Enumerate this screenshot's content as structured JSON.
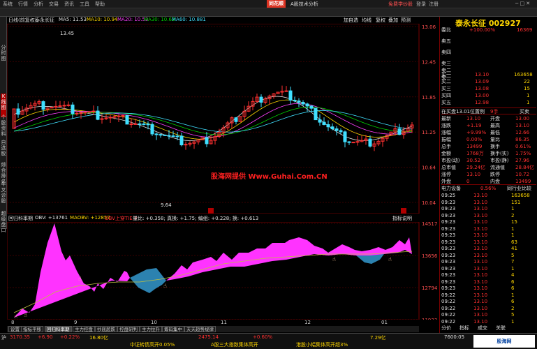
{
  "app": {
    "brand": "同花顺",
    "subtitle": "A股技术分析",
    "menus": [
      "系统",
      "行情",
      "分析",
      "交易",
      "资讯",
      "工具",
      "帮助"
    ],
    "right_links": [
      "免费学炒股",
      "登录",
      "注册"
    ]
  },
  "stock": {
    "name": "泰永长征",
    "code": "002927"
  },
  "leftbar": [
    "分时图",
    "K线图",
    "个股资料",
    "自选股",
    "综合排名",
    "牛叉诊股",
    "超级盘口"
  ],
  "kline_header": {
    "period": "日线(前复权)",
    "name": "泰永长征",
    "ma5": "MA5: 11.53",
    "ma10": "MA10: 10.94",
    "ma20": "MA20: 10.53",
    "ma30": "MA30: 10.62",
    "ma60": "MA60: 10.881",
    "buttons": [
      "加自选",
      "均线",
      "复权",
      "叠加",
      "预测"
    ]
  },
  "indicator_header": {
    "name": "回归科率期",
    "obv": "OBV: +13761",
    "maobv": "MAOBV: +12857",
    "signal": "OBV上穿TIE ↑",
    "extra": "量比: +0.358; 真换: +1.75; 编组: +0.228; 换: +0.613",
    "btn": "指标说明"
  },
  "watermark": "股海网提供 Www.Guhai.Com.CN",
  "chart_data": [
    {
      "type": "candlestick",
      "title": "泰永长征 002927 日线",
      "ylim": [
        10.04,
        13.06
      ],
      "ticks_y": [
        "13.06",
        "12.45",
        "11.85",
        "11.25",
        "10.64",
        "10.04"
      ],
      "x_ticks": [
        "08",
        "09",
        "10",
        "11",
        "12",
        "01"
      ],
      "annotations": [
        "13.45",
        "9.64"
      ],
      "ma_legend": [
        "MA5",
        "MA10",
        "MA20",
        "MA30",
        "MA60"
      ]
    },
    {
      "type": "area",
      "title": "OBV",
      "ticks_y": [
        "14517",
        "13656",
        "12794",
        "11933"
      ]
    }
  ],
  "bottom_tabs": [
    "设置",
    "指标平移",
    "回归科率期",
    "主力控盘",
    "抄底超跌",
    "控盘研判",
    "主力拉升",
    "筹码集中",
    "天天趋势规律"
  ],
  "bottom_dates": [
    "8",
    "9",
    "10",
    "11",
    "12",
    "01"
  ],
  "status": {
    "index1": "3170.35",
    "ch1": "+6.90",
    "pct1": "+0.22%",
    "v1": "16.80亿",
    "news1": "中证转债高开0.05%",
    "news2": "A股三大指数集体高开",
    "index2": "2475.14",
    "pct2": "+0.60%",
    "v2": "7.29亿",
    "news3": "港股小幅集体高开超3%"
  },
  "quote": {
    "weibi": "委比",
    "weibi_val": "+100.00%",
    "weicha": "16369",
    "sell": [
      [
        "卖五",
        "",
        ""
      ],
      [
        "卖四",
        "",
        ""
      ],
      [
        "卖三",
        "",
        ""
      ],
      [
        "卖二",
        "",
        ""
      ],
      [
        "卖一",
        "",
        ""
      ]
    ],
    "buy": [
      [
        "买一",
        "13.10",
        "163658"
      ],
      [
        "买二",
        "13.09",
        "22"
      ],
      [
        "买三",
        "13.08",
        "15"
      ],
      [
        "买四",
        "13.00",
        "1"
      ],
      [
        "买五",
        "12.98",
        "1"
      ]
    ],
    "tabs": [
      "在买盘13.01位置例",
      "9手",
      "买卖"
    ],
    "stats": [
      [
        "最新",
        "13.10",
        "开盘",
        "13.00"
      ],
      [
        "涨跌",
        "+1.19",
        "最高",
        "13.10"
      ],
      [
        "涨幅",
        "+9.99%",
        "最低",
        "12.66"
      ],
      [
        "振幅",
        "0.00%",
        "量比",
        "86.35"
      ],
      [
        "总手",
        "13499",
        "换手",
        "0.61%"
      ],
      [
        "金额",
        "1768万",
        "换手(实)",
        "1.75%"
      ],
      [
        "市盈(动)",
        "30.52",
        "市盈(静)",
        "27.96"
      ],
      [
        "总市值",
        "29.24亿",
        "流通值",
        "28.84亿"
      ],
      [
        "涨停",
        "13.10",
        "跌停",
        "10.72"
      ],
      [
        "外盘",
        "0",
        "内盘",
        "13499"
      ]
    ],
    "sector": [
      "电力设备",
      "0.56%",
      "同行业比较"
    ],
    "ticks": [
      [
        "09:25",
        "13.10",
        "163658"
      ],
      [
        "09:23",
        "13.10",
        "151"
      ],
      [
        "09:23",
        "13.10",
        "1"
      ],
      [
        "09:23",
        "13.10",
        "2"
      ],
      [
        "09:23",
        "13.10",
        "15"
      ],
      [
        "09:23",
        "13.10",
        "1"
      ],
      [
        "09:23",
        "13.10",
        "1"
      ],
      [
        "09:23",
        "13.10",
        "63"
      ],
      [
        "09:23",
        "13.10",
        "41"
      ],
      [
        "09:23",
        "13.10",
        "5"
      ],
      [
        "09:23",
        "13.10",
        "7"
      ],
      [
        "09:23",
        "13.10",
        "1"
      ],
      [
        "09:23",
        "13.10",
        "4"
      ],
      [
        "09:23",
        "13.10",
        "6"
      ],
      [
        "09:23",
        "13.10",
        "6"
      ],
      [
        "09:22",
        "13.10",
        "1"
      ],
      [
        "09:22",
        "13.10",
        "6"
      ],
      [
        "09:22",
        "13.10",
        "2"
      ],
      [
        "09:22",
        "13.10",
        "5"
      ],
      [
        "09:22",
        "13.10",
        "1"
      ]
    ],
    "bottom": [
      "分价",
      "指标",
      "成交",
      "关联"
    ]
  },
  "clock": "7600:05"
}
